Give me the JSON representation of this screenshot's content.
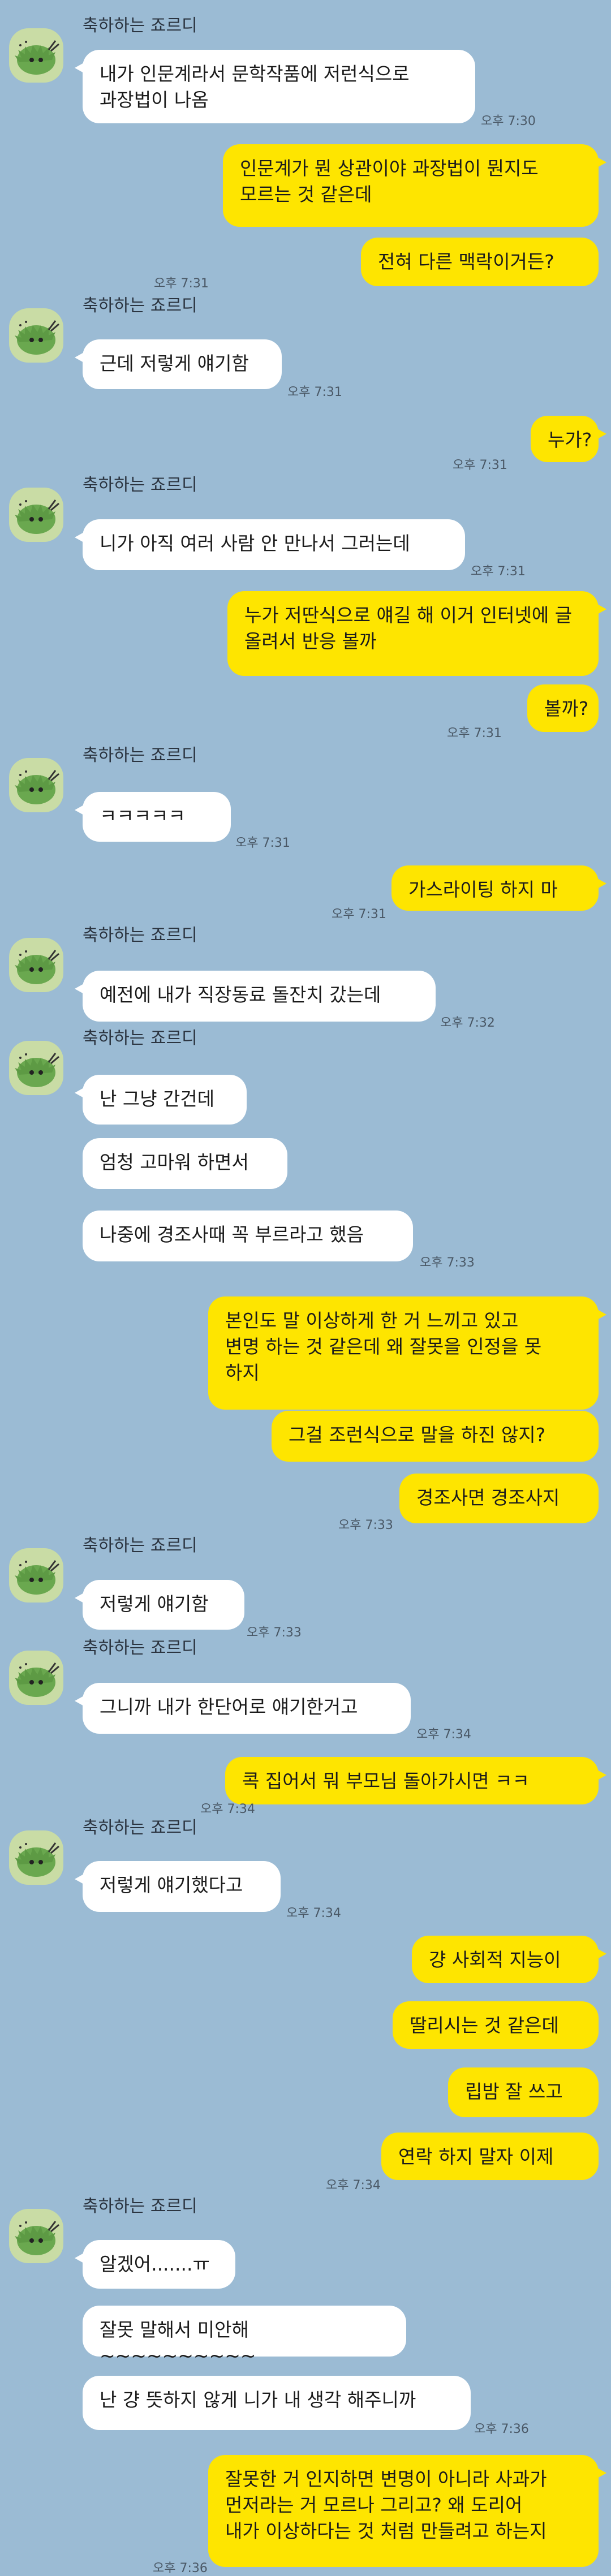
{
  "sender_name": "축하하는 죠르디",
  "avatar_icon": "jordy-avatar-icon",
  "colors": {
    "background": "#9bbbd4",
    "incoming": "#ffffff",
    "outgoing": "#fee500",
    "avatar": "#c9dca5"
  },
  "messages": [
    {
      "text": "내가 인문계라서 문학작품에 저런식으로\n과장법이 나옴",
      "time": "오후 7:30"
    },
    {
      "text": "인문계가 뭔 상관이야 과장법이 뭔지도\n모르는 것 같은데",
      "time": ""
    },
    {
      "text": "전혀 다른 맥락이거든?",
      "time": "오후 7:31"
    },
    {
      "text": "근데 저렇게 얘기함",
      "time": "오후 7:31"
    },
    {
      "text": "누가?",
      "time": "오후 7:31"
    },
    {
      "text": "니가 아직 여러 사람 안 만나서 그러는데",
      "time": "오후 7:31"
    },
    {
      "text": "누가 저딴식으로 얘길 해 이거 인터넷에 글\n올려서 반응 볼까",
      "time": ""
    },
    {
      "text": "볼까?",
      "time": "오후 7:31"
    },
    {
      "text": "ㅋㅋㅋㅋㅋ",
      "time": "오후 7:31"
    },
    {
      "text": "가스라이팅 하지 마",
      "time": "오후 7:31"
    },
    {
      "text": "예전에 내가 직장동료 돌잔치 갔는데",
      "time": "오후 7:32"
    },
    {
      "text": "난 그냥 간건데",
      "time": ""
    },
    {
      "text": "엄청 고마워 하면서",
      "time": ""
    },
    {
      "text": "나중에 경조사때 꼭 부르라고 했음",
      "time": "오후 7:33"
    },
    {
      "text": "본인도 말 이상하게 한 거 느끼고 있고\n변명 하는 것 같은데 왜 잘못을 인정을 못\n하지",
      "time": ""
    },
    {
      "text": "그걸 조런식으로 말을 하진 않지?",
      "time": ""
    },
    {
      "text": "경조사면 경조사지",
      "time": "오후 7:33"
    },
    {
      "text": "저렇게 얘기함",
      "time": "오후 7:33"
    },
    {
      "text": "그니까 내가 한단어로 얘기한거고",
      "time": "오후 7:34"
    },
    {
      "text": "콕 집어서 뭐 부모님 돌아가시면 ㅋㅋ",
      "time": "오후 7:34"
    },
    {
      "text": "저렇게 얘기했다고",
      "time": "오후 7:34"
    },
    {
      "text": "걍 사회적 지능이",
      "time": ""
    },
    {
      "text": "딸리시는 것 같은데",
      "time": ""
    },
    {
      "text": "립밤 잘 쓰고",
      "time": ""
    },
    {
      "text": "연락 하지 말자 이제",
      "time": "오후 7:34"
    },
    {
      "text": "알겠어.......ㅠ",
      "time": ""
    },
    {
      "text": "잘못 말해서 미안해~~~~~~~~~~",
      "time": ""
    },
    {
      "text": "난 걍 뜻하지 않게 니가 내 생각 해주니까",
      "time": "오후 7:36"
    },
    {
      "text": "잘못한 거 인지하면 변명이 아니라 사과가\n먼저라는 거 모르나 그리고? 왜 도리어\n내가 이상하다는 것 처럼 만들려고 하는지",
      "time": "오후 7:36"
    }
  ]
}
